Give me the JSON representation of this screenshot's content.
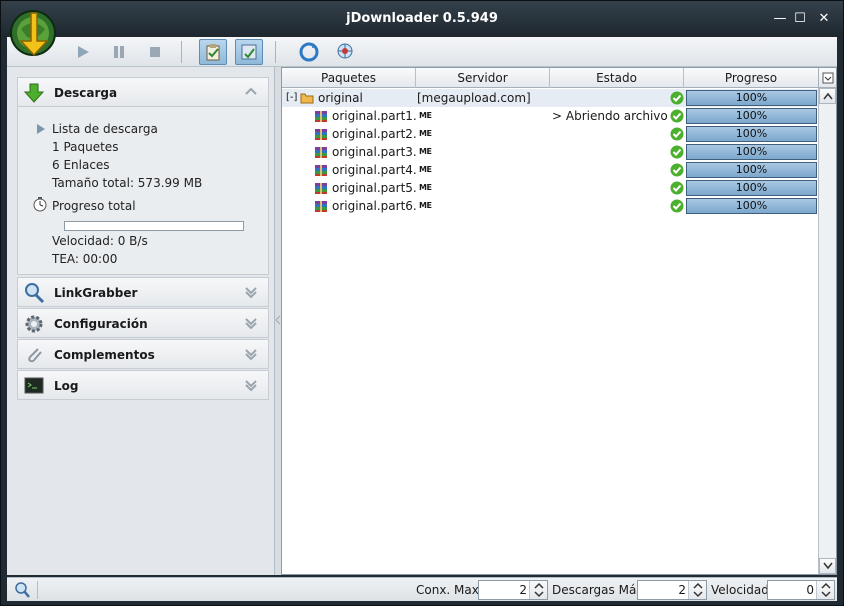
{
  "window": {
    "title": "jDownloader 0.5.949",
    "controls": {
      "minimize": "—",
      "maximize": "☐",
      "close": "✕"
    }
  },
  "toolbar": {
    "icons": [
      "play-icon",
      "pause-icon",
      "stop-icon",
      "clipboard-check-icon",
      "reconnect-toggle-icon",
      "refresh-icon",
      "update-globe-icon"
    ]
  },
  "sidebar": {
    "download": {
      "title": "Descarga",
      "list_label": "Lista de descarga",
      "packages": "1 Paquetes",
      "links": "6 Enlaces",
      "total_size": "Tamaño total: 573.99 MB",
      "total_progress_label": "Progreso total",
      "total_progress": 0.0,
      "speed": "Velocidad: 0 B/s",
      "eta": "TEA: 00:00"
    },
    "sections": [
      {
        "title": "LinkGrabber"
      },
      {
        "title": "Configuración"
      },
      {
        "title": "Complementos"
      },
      {
        "title": "Log"
      }
    ]
  },
  "table": {
    "columns": [
      "Paquetes",
      "Servidor",
      "Estado",
      "Progreso"
    ],
    "package": {
      "name": "original",
      "expander": "[-]",
      "server": "[megaupload.com]",
      "progress": "100%"
    },
    "files": [
      {
        "name": "original.part1....",
        "host": "ME",
        "status": "> Abriendo archivo",
        "progress": "100%"
      },
      {
        "name": "original.part2....",
        "host": "ME",
        "status": "",
        "progress": "100%"
      },
      {
        "name": "original.part3....",
        "host": "ME",
        "status": "",
        "progress": "100%"
      },
      {
        "name": "original.part4....",
        "host": "ME",
        "status": "",
        "progress": "100%"
      },
      {
        "name": "original.part5....",
        "host": "ME",
        "status": "",
        "progress": "100%"
      },
      {
        "name": "original.part6....",
        "host": "ME",
        "status": "",
        "progress": "100%"
      }
    ]
  },
  "statusbar": {
    "max_connections_label": "Conx. Max.",
    "max_connections": "2",
    "max_downloads_label": "Descargas Máx.",
    "max_downloads": "2",
    "speed_label": "Velocidad",
    "speed": "0"
  },
  "colors": {
    "accent": "#7ca7cc",
    "check_green": "#4caf2e",
    "titlebar": "#1e272e"
  }
}
